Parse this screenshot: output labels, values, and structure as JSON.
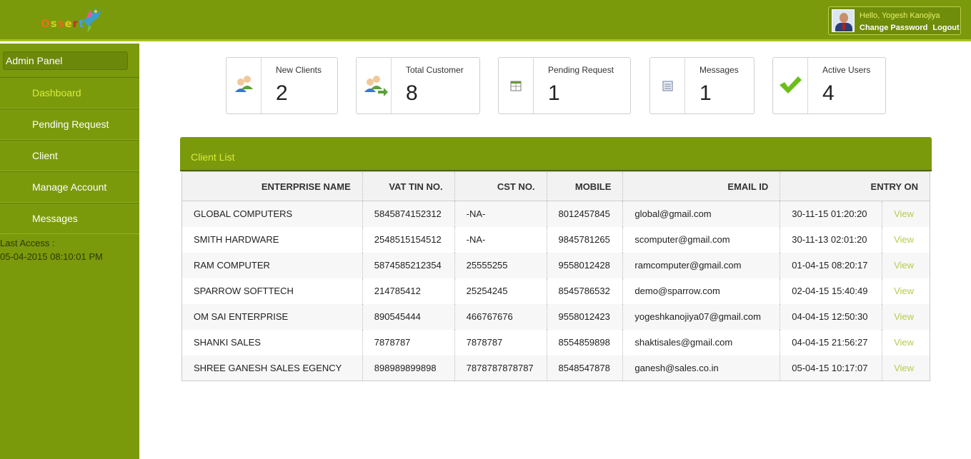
{
  "header": {
    "logo_letters": [
      "O",
      "s",
      "s",
      "e",
      "r",
      "t"
    ],
    "logo_colors": [
      "#e8701a",
      "#c8d41e",
      "#e86a1a",
      "#e8c41a",
      "#c03030",
      "#4a9ee8"
    ],
    "user_greeting": "Hello, Yogesh Kanojiya",
    "change_password": "Change Password",
    "logout": "Logout"
  },
  "sidebar": {
    "panel_title": "Admin Panel",
    "items": [
      {
        "label": "Dashboard",
        "active": true
      },
      {
        "label": "Pending Request"
      },
      {
        "label": "Client"
      },
      {
        "label": "Manage Account"
      },
      {
        "label": "Messages"
      }
    ],
    "last_access_label": "Last Access :",
    "last_access_value": "05-04-2015 08:10:01 PM"
  },
  "stats": [
    {
      "label": "New Clients",
      "value": "2",
      "icon": "users-icon"
    },
    {
      "label": "Total Customer",
      "value": "8",
      "icon": "users-forward-icon"
    },
    {
      "label": "Pending Request",
      "value": "1",
      "icon": "calendar-icon"
    },
    {
      "label": "Messages",
      "value": "1",
      "icon": "message-list-icon"
    },
    {
      "label": "Active Users",
      "value": "4",
      "icon": "checkmark-icon"
    }
  ],
  "client_list": {
    "title": "Client List",
    "columns": [
      "ENTERPRISE NAME",
      "VAT TIN NO.",
      "CST NO.",
      "MOBILE",
      "EMAIL ID",
      "ENTRY ON"
    ],
    "view_label": "View",
    "rows": [
      [
        "GLOBAL COMPUTERS",
        "5845874152312",
        "-NA-",
        "8012457845",
        "global@gmail.com",
        "30-11-15 01:20:20"
      ],
      [
        "SMITH HARDWARE",
        "2548515154512",
        "-NA-",
        "9845781265",
        "scomputer@gmail.com",
        "30-11-13 02:01:20"
      ],
      [
        "RAM COMPUTER",
        "5874585212354",
        "25555255",
        "9558012428",
        "ramcomputer@gmail.com",
        "01-04-15 08:20:17"
      ],
      [
        "SPARROW SOFTTECH",
        "214785412",
        "25254245",
        "8545786532",
        "demo@sparrow.com",
        "02-04-15 15:40:49"
      ],
      [
        "OM SAI ENTERPRISE",
        "890545444",
        "466767676",
        "9558012423",
        "yogeshkanojiya07@gmail.com",
        "04-04-15 12:50:30"
      ],
      [
        "SHANKI SALES",
        "7878787",
        "7878787",
        "8554859898",
        "shaktisales@gmail.com",
        "04-04-15 21:56:27"
      ],
      [
        "SHREE GANESH SALES EGENCY",
        "898989899898",
        "7878787878787",
        "8548547878",
        "ganesh@sales.co.in",
        "05-04-15 10:17:07"
      ]
    ]
  }
}
